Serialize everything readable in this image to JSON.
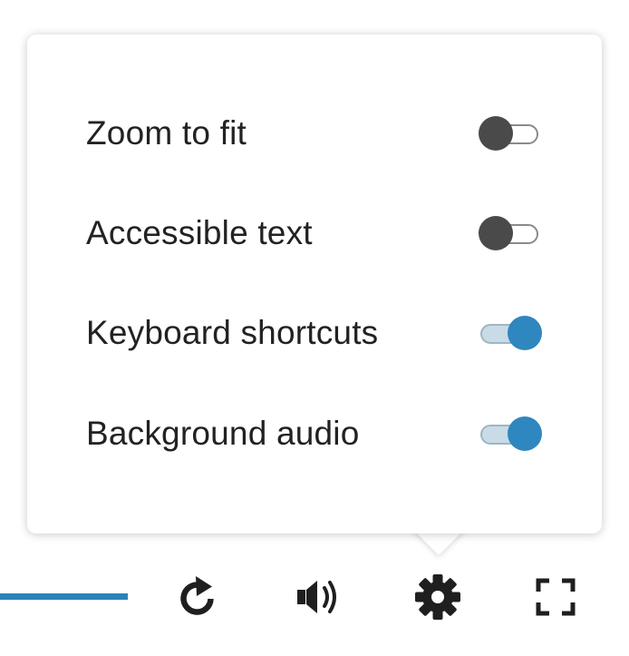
{
  "settings_menu": {
    "items": [
      {
        "label": "Zoom to fit",
        "enabled": false
      },
      {
        "label": "Accessible text",
        "enabled": false
      },
      {
        "label": "Keyboard shortcuts",
        "enabled": true
      },
      {
        "label": "Background audio",
        "enabled": true
      }
    ]
  },
  "player_controls": {
    "progress_fraction": 0.2,
    "buttons": [
      {
        "name": "replay",
        "icon": "replay-icon"
      },
      {
        "name": "volume",
        "icon": "volume-icon"
      },
      {
        "name": "settings",
        "icon": "gear-icon"
      },
      {
        "name": "fullscreen",
        "icon": "fullscreen-icon"
      }
    ]
  },
  "colors": {
    "accent": "#2f87bf",
    "toggle_off_knob": "#4a4a4a",
    "text": "#222222",
    "progress": "#2a82b8"
  }
}
